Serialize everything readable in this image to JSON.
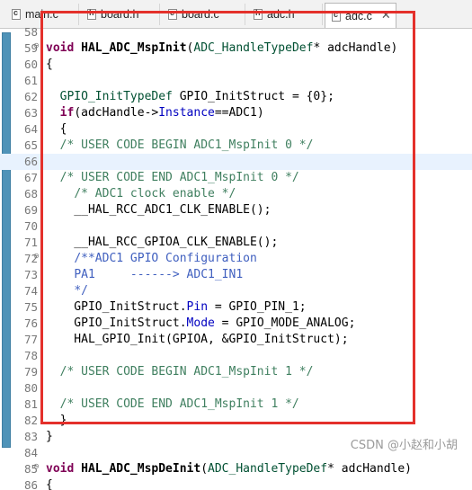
{
  "tabs": [
    {
      "name": "main.c",
      "icon": "c-file-icon",
      "glyph": "c",
      "active": false
    },
    {
      "name": "board.h",
      "icon": "h-file-icon",
      "glyph": "h",
      "active": false
    },
    {
      "name": "board.c",
      "icon": "c-file-icon",
      "glyph": "c",
      "active": false
    },
    {
      "name": "adc.h",
      "icon": "h-file-icon",
      "glyph": "h",
      "active": false
    },
    {
      "name": "adc.c",
      "icon": "c-file-icon",
      "glyph": "c",
      "active": true
    }
  ],
  "close_glyph": "✕",
  "colors": {
    "keyword": "#7f0055",
    "comment": "#3f7f5f",
    "doc_comment": "#3f5fbf",
    "field": "#0000c0",
    "type": "#005032",
    "highlight_box": "#e4302b",
    "change_bar": "#4f93b8",
    "current_line": "#e8f2fe"
  },
  "editor": {
    "lines": [
      {
        "n": "58",
        "fold": "",
        "segs": []
      },
      {
        "n": "59",
        "fold": "⊖",
        "segs": [
          [
            "kw",
            "void"
          ],
          [
            "p",
            " "
          ],
          [
            "fn",
            "HAL_ADC_MspInit"
          ],
          [
            "p",
            "("
          ],
          [
            "ty",
            "ADC_HandleTypeDef"
          ],
          [
            "p",
            "* adcHandle)"
          ]
        ]
      },
      {
        "n": "60",
        "fold": "",
        "segs": [
          [
            "p",
            "{"
          ]
        ]
      },
      {
        "n": "61",
        "fold": "",
        "segs": []
      },
      {
        "n": "62",
        "fold": "",
        "segs": [
          [
            "p",
            "  "
          ],
          [
            "ty",
            "GPIO_InitTypeDef"
          ],
          [
            "p",
            " GPIO_InitStruct = {0};"
          ]
        ]
      },
      {
        "n": "63",
        "fold": "",
        "segs": [
          [
            "p",
            "  "
          ],
          [
            "kw",
            "if"
          ],
          [
            "p",
            "(adcHandle->"
          ],
          [
            "fd",
            "Instance"
          ],
          [
            "p",
            "==ADC1)"
          ]
        ]
      },
      {
        "n": "64",
        "fold": "",
        "segs": [
          [
            "p",
            "  {"
          ]
        ]
      },
      {
        "n": "65",
        "fold": "",
        "segs": [
          [
            "p",
            "  "
          ],
          [
            "cm",
            "/* USER CODE BEGIN ADC1_MspInit 0 */"
          ]
        ]
      },
      {
        "n": "66",
        "fold": "",
        "hl": true,
        "segs": []
      },
      {
        "n": "67",
        "fold": "",
        "segs": [
          [
            "p",
            "  "
          ],
          [
            "cm",
            "/* USER CODE END ADC1_MspInit 0 */"
          ]
        ]
      },
      {
        "n": "68",
        "fold": "",
        "segs": [
          [
            "p",
            "    "
          ],
          [
            "cm",
            "/* ADC1 clock enable */"
          ]
        ]
      },
      {
        "n": "69",
        "fold": "",
        "segs": [
          [
            "p",
            "    __HAL_RCC_ADC1_CLK_ENABLE();"
          ]
        ]
      },
      {
        "n": "70",
        "fold": "",
        "segs": []
      },
      {
        "n": "71",
        "fold": "",
        "segs": [
          [
            "p",
            "    __HAL_RCC_GPIOA_CLK_ENABLE();"
          ]
        ]
      },
      {
        "n": "72",
        "fold": "⊖",
        "segs": [
          [
            "p",
            "    "
          ],
          [
            "dc",
            "/**ADC1 GPIO Configuration"
          ]
        ]
      },
      {
        "n": "73",
        "fold": "",
        "segs": [
          [
            "p",
            "    "
          ],
          [
            "dc",
            "PA1     ------> ADC1_IN1"
          ]
        ]
      },
      {
        "n": "74",
        "fold": "",
        "segs": [
          [
            "p",
            "    "
          ],
          [
            "dc",
            "*/"
          ]
        ]
      },
      {
        "n": "75",
        "fold": "",
        "segs": [
          [
            "p",
            "    GPIO_InitStruct."
          ],
          [
            "fd",
            "Pin"
          ],
          [
            "p",
            " = GPIO_PIN_1;"
          ]
        ]
      },
      {
        "n": "76",
        "fold": "",
        "segs": [
          [
            "p",
            "    GPIO_InitStruct."
          ],
          [
            "fd",
            "Mode"
          ],
          [
            "p",
            " = GPIO_MODE_ANALOG;"
          ]
        ]
      },
      {
        "n": "77",
        "fold": "",
        "segs": [
          [
            "p",
            "    HAL_GPIO_Init(GPIOA, &GPIO_InitStruct);"
          ]
        ]
      },
      {
        "n": "78",
        "fold": "",
        "segs": []
      },
      {
        "n": "79",
        "fold": "",
        "segs": [
          [
            "p",
            "  "
          ],
          [
            "cm",
            "/* USER CODE BEGIN ADC1_MspInit 1 */"
          ]
        ]
      },
      {
        "n": "80",
        "fold": "",
        "segs": []
      },
      {
        "n": "81",
        "fold": "",
        "segs": [
          [
            "p",
            "  "
          ],
          [
            "cm",
            "/* USER CODE END ADC1_MspInit 1 */"
          ]
        ]
      },
      {
        "n": "82",
        "fold": "",
        "segs": [
          [
            "p",
            "  }"
          ]
        ]
      },
      {
        "n": "83",
        "fold": "",
        "segs": [
          [
            "p",
            "}"
          ]
        ]
      },
      {
        "n": "84",
        "fold": "",
        "segs": []
      },
      {
        "n": "85",
        "fold": "⊖",
        "segs": [
          [
            "kw",
            "void"
          ],
          [
            "p",
            " "
          ],
          [
            "fn",
            "HAL_ADC_MspDeInit"
          ],
          [
            "p",
            "("
          ],
          [
            "ty",
            "ADC_HandleTypeDef"
          ],
          [
            "p",
            "* adcHandle)"
          ]
        ]
      },
      {
        "n": "86",
        "fold": "",
        "segs": [
          [
            "p",
            "{"
          ]
        ]
      }
    ]
  },
  "watermark": "CSDN @小赵和小胡"
}
